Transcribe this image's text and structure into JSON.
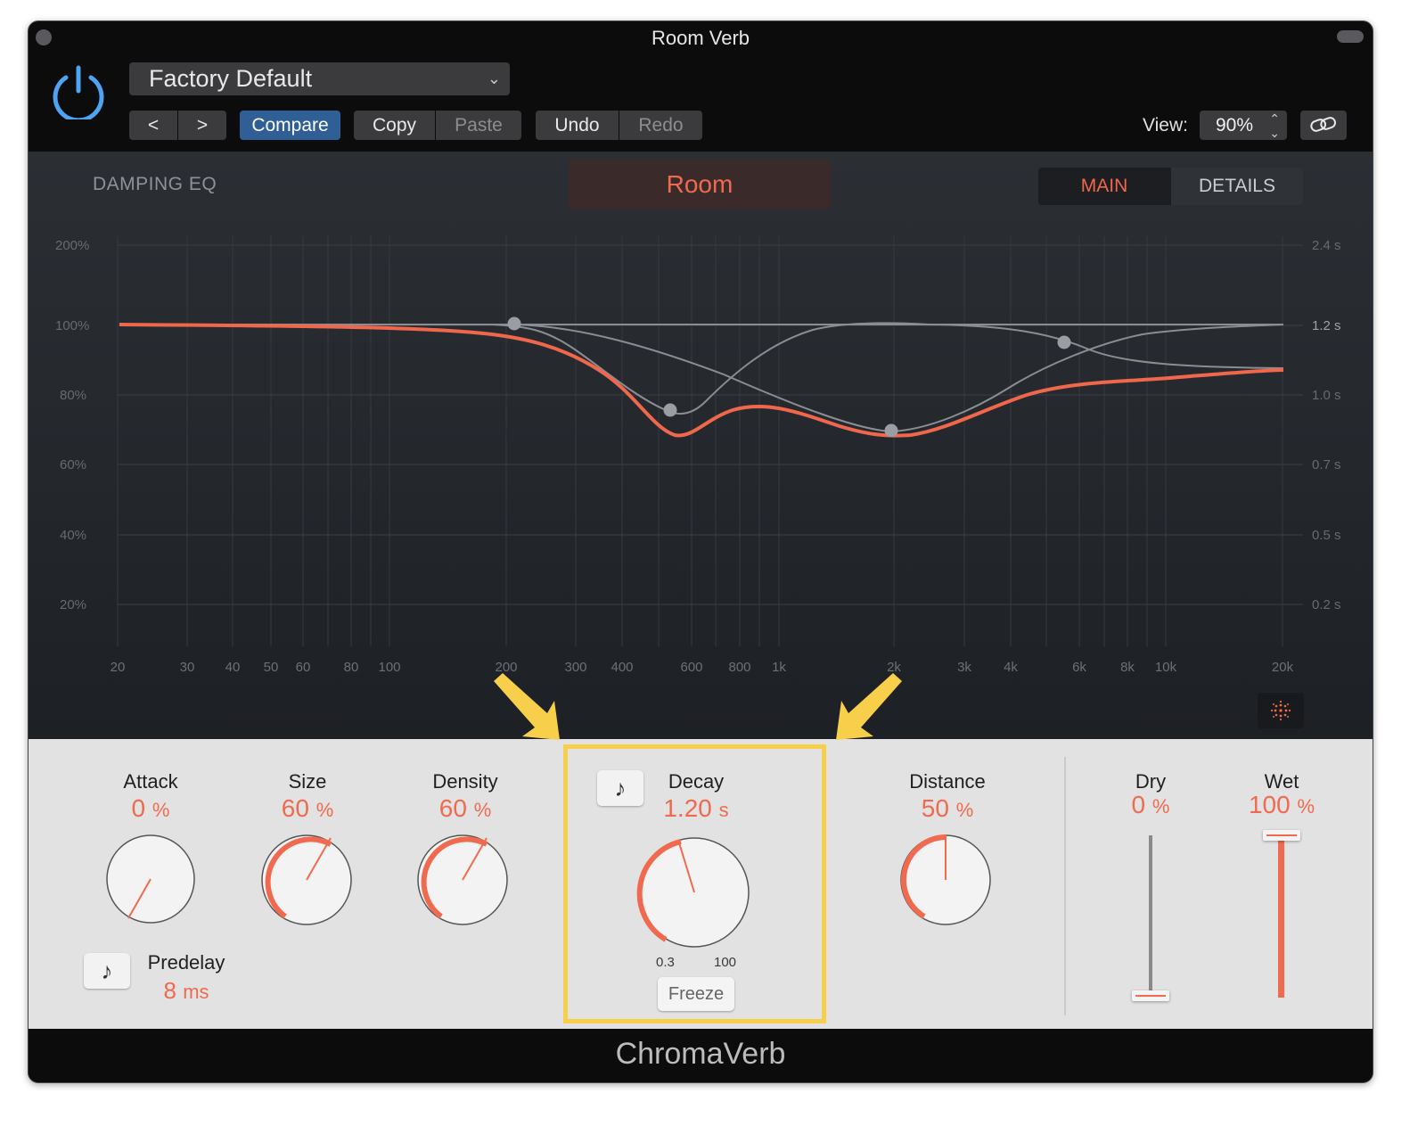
{
  "window": {
    "title": "Room Verb"
  },
  "toolbar": {
    "preset": "Factory Default",
    "prev_label": "<",
    "next_label": ">",
    "compare_label": "Compare",
    "copy_label": "Copy",
    "paste_label": "Paste",
    "undo_label": "Undo",
    "redo_label": "Redo",
    "view_label": "View:",
    "view_value": "90%"
  },
  "eq": {
    "title": "DAMPING EQ",
    "mode": "Room",
    "tabs": [
      "MAIN",
      "DETAILS"
    ],
    "active_tab": "MAIN",
    "y_left_labels": [
      "200%",
      "100%",
      "80%",
      "60%",
      "40%",
      "20%"
    ],
    "y_right_labels": [
      "2.4 s",
      "1.2 s",
      "1.0 s",
      "0.7 s",
      "0.5 s",
      "0.2 s"
    ],
    "x_labels": [
      "20",
      "30",
      "40",
      "50",
      "60",
      "80",
      "100",
      "200",
      "300",
      "400",
      "600",
      "800",
      "1k",
      "2k",
      "3k",
      "4k",
      "6k",
      "8k",
      "10k",
      "20k"
    ],
    "curve_color": "#f0674b"
  },
  "params": {
    "attack": {
      "label": "Attack",
      "value": "0",
      "unit": "%",
      "fraction": 0.0
    },
    "size": {
      "label": "Size",
      "value": "60",
      "unit": "%",
      "fraction": 0.6
    },
    "density": {
      "label": "Density",
      "value": "60",
      "unit": "%",
      "fraction": 0.6
    },
    "decay": {
      "label": "Decay",
      "value": "1.20",
      "unit": "s",
      "min_label": "0.3",
      "max_label": "100",
      "freeze_label": "Freeze"
    },
    "distance": {
      "label": "Distance",
      "value": "50",
      "unit": "%",
      "fraction": 0.5
    },
    "dry": {
      "label": "Dry",
      "value": "0",
      "unit": "%",
      "fraction": 0.0
    },
    "wet": {
      "label": "Wet",
      "value": "100",
      "unit": "%",
      "fraction": 1.0
    },
    "predelay": {
      "label": "Predelay",
      "value": "8",
      "unit": "ms"
    }
  },
  "footer": {
    "name": "ChromaVerb"
  },
  "colors": {
    "accent": "#f06a4f",
    "highlight": "#f7cf4a",
    "compare_blue": "#2f5f95"
  }
}
